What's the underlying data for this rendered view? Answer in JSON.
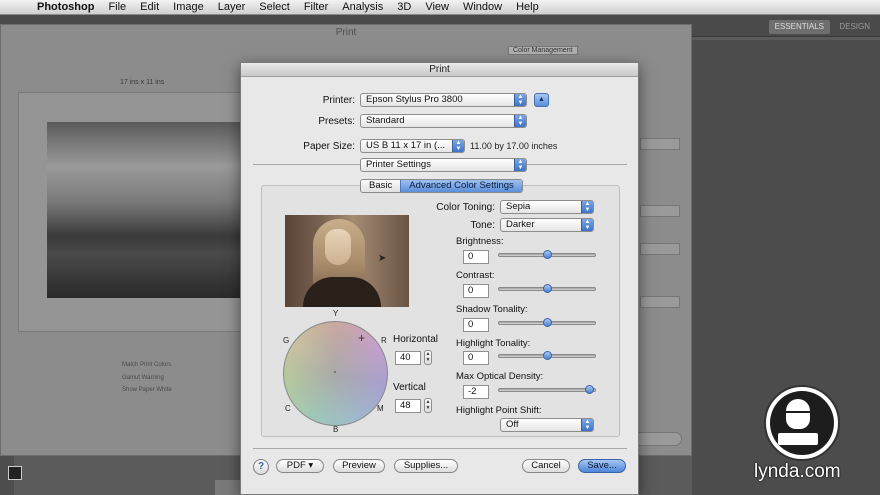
{
  "menubar": {
    "app_name": "Photoshop",
    "items": [
      "File",
      "Edit",
      "Image",
      "Layer",
      "Select",
      "Filter",
      "Analysis",
      "3D",
      "View",
      "Window",
      "Help"
    ]
  },
  "workspace": {
    "active": "ESSENTIALS",
    "other": "DESIGN"
  },
  "background_dialog": {
    "title": "Print",
    "size_label": "17 ins x 11 ins",
    "color_management": "Color Management",
    "options": [
      "Match Print Colors",
      "Gamut Warning",
      "Show Paper White"
    ]
  },
  "dialog": {
    "title": "Print",
    "printer_label": "Printer:",
    "printer_value": "Epson Stylus Pro 3800",
    "presets_label": "Presets:",
    "presets_value": "Standard",
    "paper_label": "Paper Size:",
    "paper_value": "US B 11 x 17 in (...",
    "paper_dim": "11.00 by 17.00 inches",
    "section_value": "Printer Settings",
    "tabs": [
      {
        "label": "Basic",
        "active": false
      },
      {
        "label": "Advanced Color Settings",
        "active": true
      }
    ],
    "color_toning_label": "Color Toning:",
    "color_toning_value": "Sepia",
    "tone_label": "Tone:",
    "tone_value": "Darker",
    "wheel_labels": {
      "top": "Y",
      "left_top": "G",
      "right_top": "R",
      "left_bottom": "C",
      "right_bottom": "M",
      "bottom": "B"
    },
    "horizontal_label": "Horizontal",
    "horizontal_value": "40",
    "vertical_label": "Vertical",
    "vertical_value": "48",
    "sliders": [
      {
        "label": "Brightness:",
        "value": "0",
        "level": 0.5
      },
      {
        "label": "Contrast:",
        "value": "0",
        "level": 0.5
      },
      {
        "label": "Shadow Tonality:",
        "value": "0",
        "level": 0.5
      },
      {
        "label": "Highlight Tonality:",
        "value": "0",
        "level": 0.5
      },
      {
        "label": "Max Optical Density:",
        "value": "-2",
        "level": 0.94
      }
    ],
    "highlight_shift_label": "Highlight Point Shift:",
    "highlight_shift_value": "Off",
    "buttons": {
      "help": "?",
      "pdf": "PDF ▾",
      "preview": "Preview",
      "supplies": "Supplies...",
      "cancel": "Cancel",
      "save": "Save..."
    }
  },
  "watermark": {
    "text": "lynda.com"
  }
}
